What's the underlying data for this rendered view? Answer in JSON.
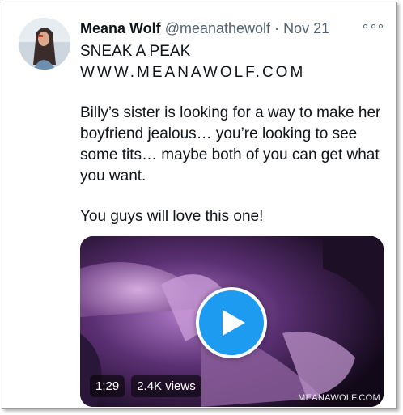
{
  "tweet": {
    "author_name": "Meana Wolf",
    "handle": "@meanathewolf",
    "separator": "·",
    "date": "Nov 21",
    "lines": [
      "SNEAK A PEAK",
      "WWW.MEANAWOLF.COM",
      "Billy’s sister is looking for a way to make her",
      "boyfriend jealous… you’re looking to see",
      "some tits… maybe both of you can get what",
      "you want.",
      "You guys will love this one!"
    ],
    "more_icon": "more-horizontal-icon"
  },
  "video": {
    "duration": "1:29",
    "views": "2.4K views",
    "watermark": "MEANAWOLF.COM",
    "play_icon": "play-icon",
    "accent": "#1d9bf0"
  }
}
